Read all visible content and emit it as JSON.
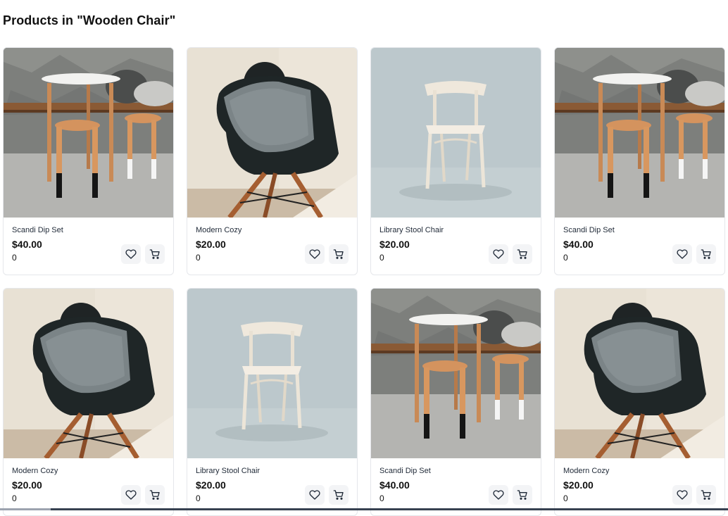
{
  "page": {
    "title": "Products in \"Wooden Chair\""
  },
  "products": [
    {
      "name": "Scandi Dip Set",
      "price": "$40.00",
      "rating": "0",
      "image": "scandi"
    },
    {
      "name": "Modern Cozy",
      "price": "$20.00",
      "rating": "0",
      "image": "modern"
    },
    {
      "name": "Library Stool Chair",
      "price": "$20.00",
      "rating": "0",
      "image": "library"
    },
    {
      "name": "Scandi Dip Set",
      "price": "$40.00",
      "rating": "0",
      "image": "scandi"
    },
    {
      "name": "Modern Cozy",
      "price": "$20.00",
      "rating": "0",
      "image": "modern"
    },
    {
      "name": "Library Stool Chair",
      "price": "$20.00",
      "rating": "0",
      "image": "library"
    },
    {
      "name": "Scandi Dip Set",
      "price": "$40.00",
      "rating": "0",
      "image": "scandi"
    },
    {
      "name": "Modern Cozy",
      "price": "$20.00",
      "rating": "0",
      "image": "modern"
    }
  ],
  "icons": {
    "wishlist": "heart-icon",
    "cart": "cart-icon"
  }
}
